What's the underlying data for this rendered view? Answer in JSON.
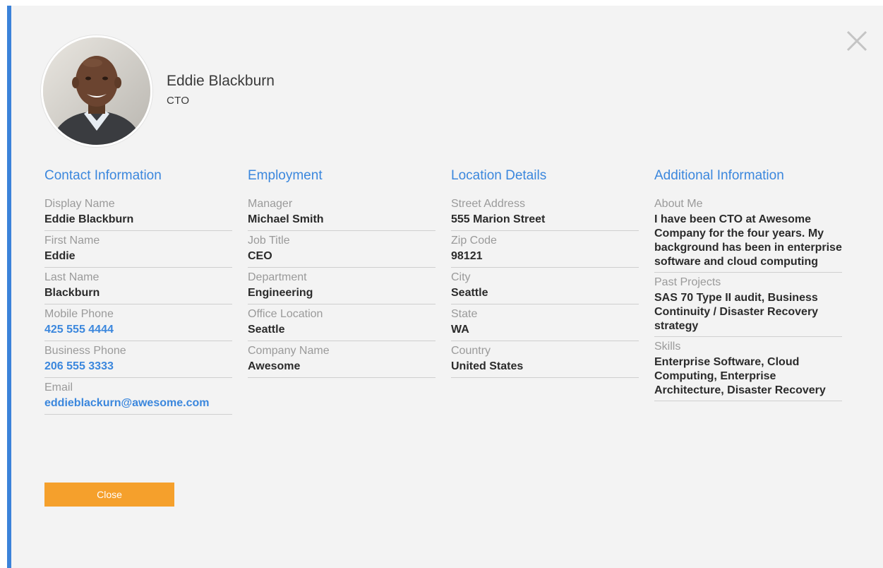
{
  "profile": {
    "name": "Eddie Blackburn",
    "title": "CTO"
  },
  "contact": {
    "heading": "Contact Information",
    "fields": [
      {
        "label": "Display Name",
        "value": "Eddie Blackburn"
      },
      {
        "label": "First Name",
        "value": "Eddie"
      },
      {
        "label": "Last Name",
        "value": "Blackburn"
      },
      {
        "label": "Mobile Phone",
        "value": "425 555 4444"
      },
      {
        "label": "Business Phone",
        "value": "206 555 3333"
      },
      {
        "label": "Email",
        "value": "eddieblackurn@awesome.com"
      }
    ]
  },
  "employment": {
    "heading": "Employment",
    "fields": [
      {
        "label": "Manager",
        "value": "Michael Smith"
      },
      {
        "label": "Job Title",
        "value": "CEO"
      },
      {
        "label": "Department",
        "value": "Engineering"
      },
      {
        "label": "Office Location",
        "value": "Seattle"
      },
      {
        "label": "Company Name",
        "value": "Awesome"
      }
    ]
  },
  "location": {
    "heading": "Location Details",
    "fields": [
      {
        "label": "Street Address",
        "value": "555 Marion Street"
      },
      {
        "label": "Zip Code",
        "value": "98121"
      },
      {
        "label": "City",
        "value": "Seattle"
      },
      {
        "label": "State",
        "value": "WA"
      },
      {
        "label": "Country",
        "value": "United States"
      }
    ]
  },
  "additional": {
    "heading": "Additional Information",
    "fields": [
      {
        "label": "About Me",
        "value": "I have been CTO at Awesome Company for the four years. My background has been in enterprise software and cloud computing"
      },
      {
        "label": "Past Projects",
        "value": "SAS 70 Type II audit, Business Continuity / Disaster Recovery strategy"
      },
      {
        "label": "Skills",
        "value": "Enterprise Software, Cloud Computing, Enterprise Architecture, Disaster Recovery"
      }
    ]
  },
  "actions": {
    "close_label": "Close"
  },
  "colors": {
    "accent": "#3b87dd",
    "button": "#f5a02c",
    "left_bar": "#3b82d9"
  },
  "icons": {
    "close": "close-icon",
    "avatar": "profile-photo"
  }
}
